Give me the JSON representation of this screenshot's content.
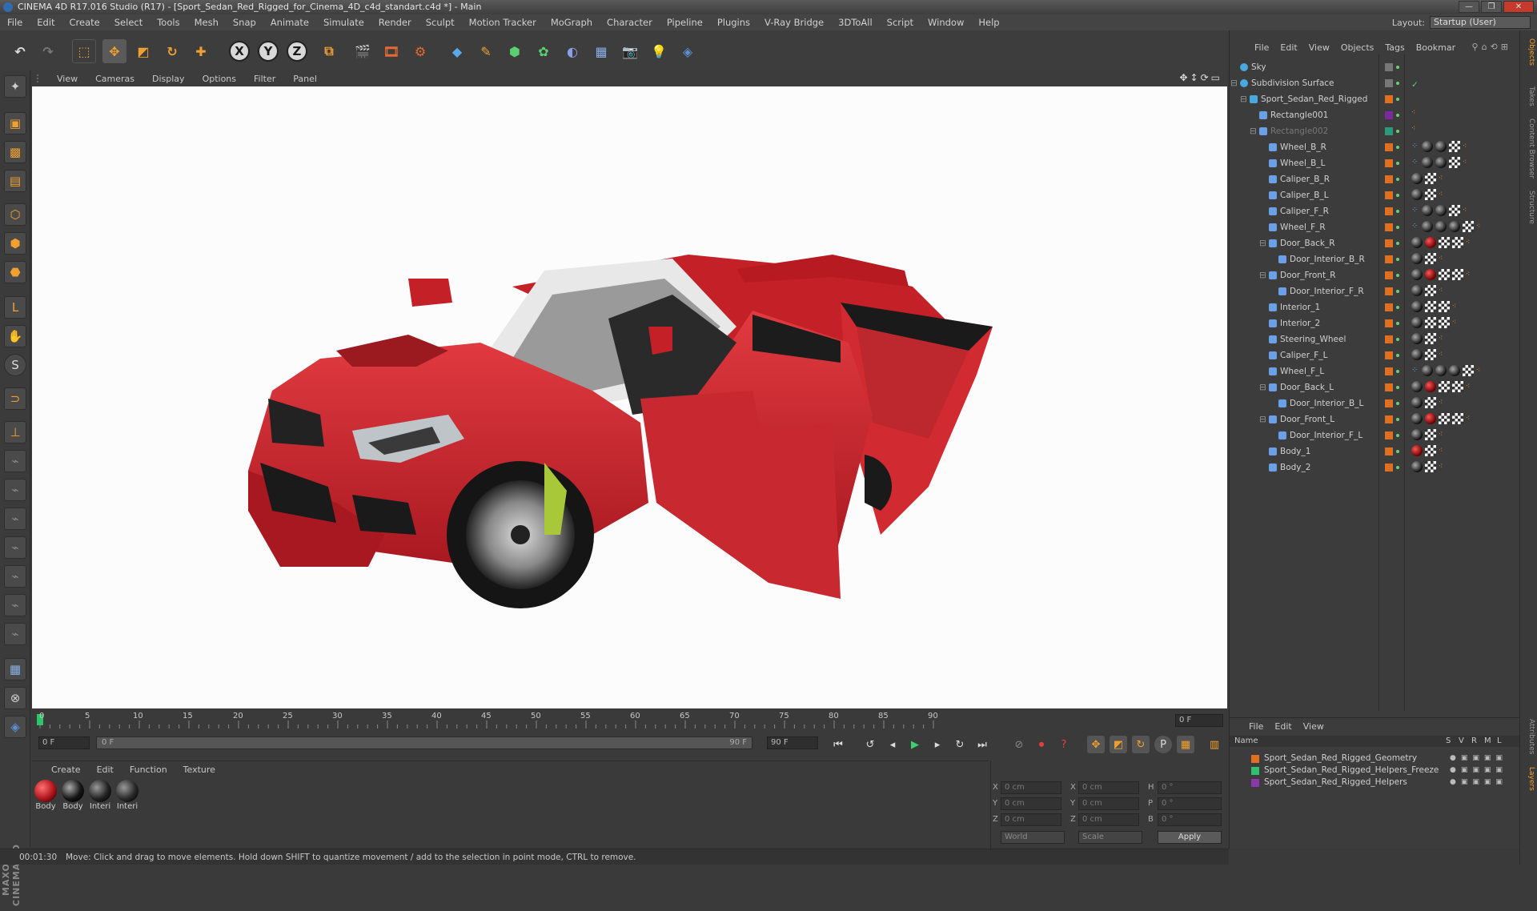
{
  "window": {
    "title": "CINEMA 4D R17.016 Studio (R17) - [Sport_Sedan_Red_Rigged_for_Cinema_4D_c4d_standart.c4d *] - Main",
    "controls": [
      "—",
      "❐",
      "✕"
    ]
  },
  "menubar": {
    "items": [
      "File",
      "Edit",
      "Create",
      "Select",
      "Tools",
      "Mesh",
      "Snap",
      "Animate",
      "Simulate",
      "Render",
      "Sculpt",
      "Motion Tracker",
      "MoGraph",
      "Character",
      "Pipeline",
      "Plugins",
      "V-Ray Bridge",
      "3DToAll",
      "Script",
      "Window",
      "Help"
    ],
    "layout_label": "Layout:",
    "layout_value": "Startup (User)"
  },
  "toolbar": {
    "axes": [
      "X",
      "Y",
      "Z"
    ]
  },
  "viewport": {
    "menu": [
      "View",
      "Cameras",
      "Display",
      "Options",
      "Filter",
      "Panel"
    ],
    "body_color": "#c8232c"
  },
  "timeline": {
    "ticks": [
      "0",
      "5",
      "10",
      "15",
      "20",
      "25",
      "30",
      "35",
      "40",
      "45",
      "50",
      "55",
      "60",
      "65",
      "70",
      "75",
      "80",
      "85",
      "90"
    ],
    "end_frame": "0 F",
    "current_frame": "0 F",
    "range_start": "0 F",
    "range_end": "90 F",
    "max_frame": "90 F"
  },
  "materials": {
    "menu": [
      "Create",
      "Edit",
      "Function",
      "Texture"
    ],
    "items": [
      {
        "label": "Body",
        "color": "#b0141c"
      },
      {
        "label": "Body",
        "color": "#151515"
      },
      {
        "label": "Interi",
        "color": "#222222"
      },
      {
        "label": "Interi",
        "color": "#2a2a2a"
      }
    ]
  },
  "coordinates": {
    "rows": [
      {
        "a": "X",
        "av": "0 cm",
        "b": "X",
        "bv": "0 cm",
        "c": "H",
        "cv": "0 °"
      },
      {
        "a": "Y",
        "av": "0 cm",
        "b": "Y",
        "bv": "0 cm",
        "c": "P",
        "cv": "0 °"
      },
      {
        "a": "Z",
        "av": "0 cm",
        "b": "Z",
        "bv": "0 cm",
        "c": "B",
        "cv": "0 °"
      }
    ],
    "mode_world": "World",
    "mode_scale": "Scale",
    "apply": "Apply"
  },
  "status": {
    "time": "00:01:30",
    "message": "Move: Click and drag to move elements. Hold down SHIFT to quantize movement / add to the selection in point mode, CTRL to remove."
  },
  "objects": {
    "menu": [
      "File",
      "Edit",
      "View",
      "Objects",
      "Tags",
      "Bookmar"
    ],
    "items": [
      {
        "name": "Sky",
        "depth": 0,
        "color": "#777777",
        "tags": ""
      },
      {
        "name": "Subdivision Surface",
        "depth": 0,
        "color": "#777777",
        "tags": "check"
      },
      {
        "name": "Sport_Sedan_Red_Rigged",
        "depth": 1,
        "color": "#e07020",
        "tags": ""
      },
      {
        "name": "Rectangle001",
        "depth": 2,
        "color": "#7a2a9a",
        "tags": "dots"
      },
      {
        "name": "Rectangle002",
        "depth": 2,
        "color": "#2a9a7a",
        "tags": "dots",
        "dim": true
      },
      {
        "name": "Wheel_B_R",
        "depth": 3,
        "color": "#e07020",
        "tags": "bbcd"
      },
      {
        "name": "Wheel_B_L",
        "depth": 3,
        "color": "#e07020",
        "tags": "bbcd"
      },
      {
        "name": "Caliper_B_R",
        "depth": 3,
        "color": "#e07020",
        "tags": "bcd"
      },
      {
        "name": "Caliper_B_L",
        "depth": 3,
        "color": "#e07020",
        "tags": "bcd"
      },
      {
        "name": "Caliper_F_R",
        "depth": 3,
        "color": "#e07020",
        "tags": "bbcd"
      },
      {
        "name": "Wheel_F_R",
        "depth": 3,
        "color": "#e07020",
        "tags": "bbbcd"
      },
      {
        "name": "Door_Back_R",
        "depth": 3,
        "color": "#e07020",
        "tags": "brccd"
      },
      {
        "name": "Door_Interior_B_R",
        "depth": 4,
        "color": "#e07020",
        "tags": "bcd"
      },
      {
        "name": "Door_Front_R",
        "depth": 3,
        "color": "#e07020",
        "tags": "brccd"
      },
      {
        "name": "Door_Interior_F_R",
        "depth": 4,
        "color": "#e07020",
        "tags": "bcd"
      },
      {
        "name": "Interior_1",
        "depth": 3,
        "color": "#e07020",
        "tags": "bccd"
      },
      {
        "name": "Interior_2",
        "depth": 3,
        "color": "#e07020",
        "tags": "bccd"
      },
      {
        "name": "Steering_Wheel",
        "depth": 3,
        "color": "#e07020",
        "tags": "bcd"
      },
      {
        "name": "Caliper_F_L",
        "depth": 3,
        "color": "#e07020",
        "tags": "bcd"
      },
      {
        "name": "Wheel_F_L",
        "depth": 3,
        "color": "#e07020",
        "tags": "bbbcd"
      },
      {
        "name": "Door_Back_L",
        "depth": 3,
        "color": "#e07020",
        "tags": "brccd"
      },
      {
        "name": "Door_Interior_B_L",
        "depth": 4,
        "color": "#e07020",
        "tags": "bcd"
      },
      {
        "name": "Door_Front_L",
        "depth": 3,
        "color": "#e07020",
        "tags": "brccd"
      },
      {
        "name": "Door_Interior_F_L",
        "depth": 4,
        "color": "#e07020",
        "tags": "bcd"
      },
      {
        "name": "Body_1",
        "depth": 3,
        "color": "#e07020",
        "tags": "rcd"
      },
      {
        "name": "Body_2",
        "depth": 3,
        "color": "#e07020",
        "tags": "bcd"
      }
    ]
  },
  "layers": {
    "menu": [
      "File",
      "Edit",
      "View"
    ],
    "header_name": "Name",
    "header_cols": [
      "S",
      "V",
      "R",
      "M",
      "L"
    ],
    "items": [
      {
        "name": "Sport_Sedan_Red_Rigged_Geometry",
        "color": "#e07020"
      },
      {
        "name": "Sport_Sedan_Red_Rigged_Helpers_Freeze",
        "color": "#30c070"
      },
      {
        "name": "Sport_Sedan_Red_Rigged_Helpers",
        "color": "#8a3aa8"
      }
    ]
  },
  "right_tabs": [
    "Objects",
    "Takes",
    "Content Browser",
    "Structure",
    "Attributes",
    "Layers"
  ],
  "branding": "MAXON CINEMA 4D"
}
